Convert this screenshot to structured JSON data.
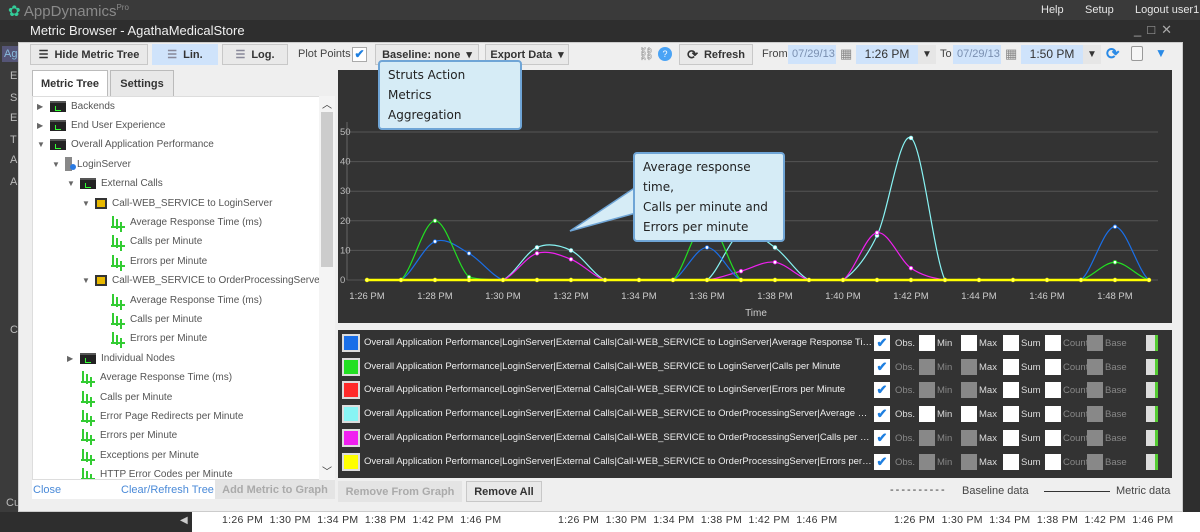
{
  "app": {
    "name": "AppDynamics",
    "edition": "Pro",
    "links": [
      "Help",
      "Setup",
      "Logout user1"
    ]
  },
  "left_strip": [
    "Ag",
    "E",
    "S",
    "E",
    "T",
    "A",
    "A",
    "C",
    "Cu"
  ],
  "dialog": {
    "title": "Metric Browser - AgathaMedicalStore"
  },
  "toolbar": {
    "hide_tree": "Hide Metric Tree",
    "lin": "Lin.",
    "log": "Log.",
    "plot_points": "Plot Points",
    "plot_points_checked": true,
    "baseline": "Baseline:  none",
    "export": "Export Data",
    "refresh": "Refresh",
    "from": "From",
    "from_date": "07/29/13",
    "from_time": "1:26 PM",
    "to": "To",
    "to_date": "07/29/13",
    "to_time": "1:50 PM"
  },
  "tabs": [
    "Metric Tree",
    "Settings"
  ],
  "tree": [
    {
      "label": "Backends",
      "indent": 0,
      "type": "folder",
      "expand": "collapsed"
    },
    {
      "label": "End User Experience",
      "indent": 0,
      "type": "folder",
      "expand": "collapsed"
    },
    {
      "label": "Overall Application Performance",
      "indent": 0,
      "type": "folder",
      "expand": "expanded"
    },
    {
      "label": "LoginServer",
      "indent": 1,
      "type": "server",
      "expand": "expanded"
    },
    {
      "label": "External Calls",
      "indent": 2,
      "type": "folder",
      "expand": "expanded"
    },
    {
      "label": "Call-WEB_SERVICE to LoginServer",
      "indent": 3,
      "type": "service",
      "expand": "expanded"
    },
    {
      "label": "Average Response Time (ms)",
      "indent": 4,
      "type": "metric"
    },
    {
      "label": "Calls per Minute",
      "indent": 4,
      "type": "metric"
    },
    {
      "label": "Errors per Minute",
      "indent": 4,
      "type": "metric"
    },
    {
      "label": "Call-WEB_SERVICE to OrderProcessingServer",
      "indent": 3,
      "type": "service",
      "expand": "expanded"
    },
    {
      "label": "Average Response Time (ms)",
      "indent": 4,
      "type": "metric"
    },
    {
      "label": "Calls per Minute",
      "indent": 4,
      "type": "metric"
    },
    {
      "label": "Errors per Minute",
      "indent": 4,
      "type": "metric"
    },
    {
      "label": "Individual Nodes",
      "indent": 2,
      "type": "folder",
      "expand": "collapsed"
    },
    {
      "label": "Average Response Time (ms)",
      "indent": 2,
      "type": "metric"
    },
    {
      "label": "Calls per Minute",
      "indent": 2,
      "type": "metric"
    },
    {
      "label": "Error Page Redirects per Minute",
      "indent": 2,
      "type": "metric"
    },
    {
      "label": "Errors per Minute",
      "indent": 2,
      "type": "metric"
    },
    {
      "label": "Exceptions per Minute",
      "indent": 2,
      "type": "metric"
    },
    {
      "label": "HTTP Error Codes per Minute",
      "indent": 2,
      "type": "metric"
    }
  ],
  "tree_footer": {
    "close": "Close",
    "clear": "Clear/Refresh Tree",
    "add": "Add Metric to Graph"
  },
  "callouts": {
    "struts": [
      "Struts Action Metrics",
      "Aggregation"
    ],
    "chart": [
      "Average response time,",
      "Calls per minute and",
      "Errors per minute"
    ]
  },
  "chart_data": {
    "type": "line",
    "xlabel": "Time",
    "ylabel": "",
    "ylim": [
      0,
      55
    ],
    "yticks": [
      0,
      10,
      20,
      30,
      40,
      50
    ],
    "grid": true,
    "x": [
      "1:26 PM",
      "1:27 PM",
      "1:28 PM",
      "1:29 PM",
      "1:30 PM",
      "1:31 PM",
      "1:32 PM",
      "1:33 PM",
      "1:34 PM",
      "1:35 PM",
      "1:36 PM",
      "1:37 PM",
      "1:38 PM",
      "1:39 PM",
      "1:40 PM",
      "1:41 PM",
      "1:42 PM",
      "1:43 PM",
      "1:44 PM",
      "1:45 PM",
      "1:46 PM",
      "1:47 PM",
      "1:48 PM",
      "1:49 PM"
    ],
    "xticks": [
      "1:26 PM",
      "1:28 PM",
      "1:30 PM",
      "1:32 PM",
      "1:34 PM",
      "1:36 PM",
      "1:38 PM",
      "1:40 PM",
      "1:42 PM",
      "1:44 PM",
      "1:46 PM",
      "1:48 PM"
    ],
    "series": [
      {
        "name": "Overall Application Performance|LoginServer|External Calls|Call-WEB_SERVICE to LoginServer|Average Response Time (ms)",
        "color": "#1a6fe8",
        "values": [
          0,
          0,
          13,
          9,
          0,
          0,
          0,
          0,
          0,
          0,
          11,
          0,
          0,
          0,
          0,
          0,
          0,
          0,
          0,
          0,
          0,
          0,
          18,
          0
        ]
      },
      {
        "name": "Overall Application Performance|LoginServer|External Calls|Call-WEB_SERVICE to LoginServer|Calls per Minute",
        "color": "#22e022",
        "values": [
          0,
          0,
          20,
          1,
          0,
          0,
          0,
          0,
          0,
          0,
          20,
          0,
          0,
          0,
          0,
          0,
          0,
          0,
          0,
          0,
          0,
          0,
          6,
          0
        ]
      },
      {
        "name": "Overall Application Performance|LoginServer|External Calls|Call-WEB_SERVICE to LoginServer|Errors per Minute",
        "color": "#ff2a2a",
        "values": [
          0,
          0,
          0,
          0,
          0,
          0,
          0,
          0,
          0,
          0,
          0,
          0,
          0,
          0,
          0,
          0,
          0,
          0,
          0,
          0,
          0,
          0,
          0,
          0
        ]
      },
      {
        "name": "Overall Application Performance|LoginServer|External Calls|Call-WEB_SERVICE to OrderProcessingServer|Average Response Time (ms)",
        "color": "#88f4f4",
        "values": [
          0,
          0,
          0,
          0,
          0,
          11,
          10,
          0,
          0,
          0,
          0,
          16,
          11,
          0,
          0,
          15,
          48,
          0,
          0,
          0,
          0,
          0,
          0,
          0
        ]
      },
      {
        "name": "Overall Application Performance|LoginServer|External Calls|Call-WEB_SERVICE to OrderProcessingServer|Calls per Minute",
        "color": "#f020f0",
        "values": [
          0,
          0,
          0,
          0,
          0,
          9,
          7,
          0,
          0,
          0,
          0,
          3,
          6,
          0,
          0,
          16,
          4,
          0,
          0,
          0,
          0,
          0,
          0,
          0
        ]
      },
      {
        "name": "Overall Application Performance|LoginServer|External Calls|Call-WEB_SERVICE to OrderProcessingServer|Errors per Minute",
        "color": "#ffff00",
        "values": [
          0,
          0,
          0,
          0,
          0,
          0,
          0,
          0,
          0,
          0,
          0,
          0,
          0,
          0,
          0,
          0,
          0,
          0,
          0,
          0,
          0,
          0,
          0,
          0
        ]
      }
    ]
  },
  "legend": {
    "labels": [
      "Overall Application Performance|LoginServer|External Calls|Call-WEB_SERVICE to LoginServer|Average Response Time (...",
      "Overall Application Performance|LoginServer|External Calls|Call-WEB_SERVICE to LoginServer|Calls per Minute",
      "Overall Application Performance|LoginServer|External Calls|Call-WEB_SERVICE to LoginServer|Errors per Minute",
      "Overall Application Performance|LoginServer|External Calls|Call-WEB_SERVICE to OrderProcessingServer|Average Respo...",
      "Overall Application Performance|LoginServer|External Calls|Call-WEB_SERVICE to OrderProcessingServer|Calls per Minute",
      "Overall Application Performance|LoginServer|External Calls|Call-WEB_SERVICE to OrderProcessingServer|Errors per Minute"
    ],
    "options": [
      "Obs.",
      "Min",
      "Max",
      "Sum",
      "Count",
      "Base"
    ],
    "enabled": [
      [
        true,
        true,
        true,
        true,
        false
      ],
      [
        false,
        false,
        true,
        true,
        false
      ],
      [
        false,
        false,
        true,
        true,
        false
      ],
      [
        true,
        true,
        true,
        true,
        false
      ],
      [
        false,
        false,
        true,
        true,
        false
      ],
      [
        false,
        false,
        true,
        true,
        false
      ]
    ],
    "shown": [
      true,
      true,
      true,
      true,
      true,
      true
    ]
  },
  "bottom": {
    "remove": "Remove From Graph",
    "remove_all": "Remove All",
    "baseline_key": "Baseline data",
    "metric_key": "Metric data"
  },
  "background_timeline": "1:26 PM  1:30 PM  1:34 PM  1:38 PM  1:42 PM  1:46 PM"
}
